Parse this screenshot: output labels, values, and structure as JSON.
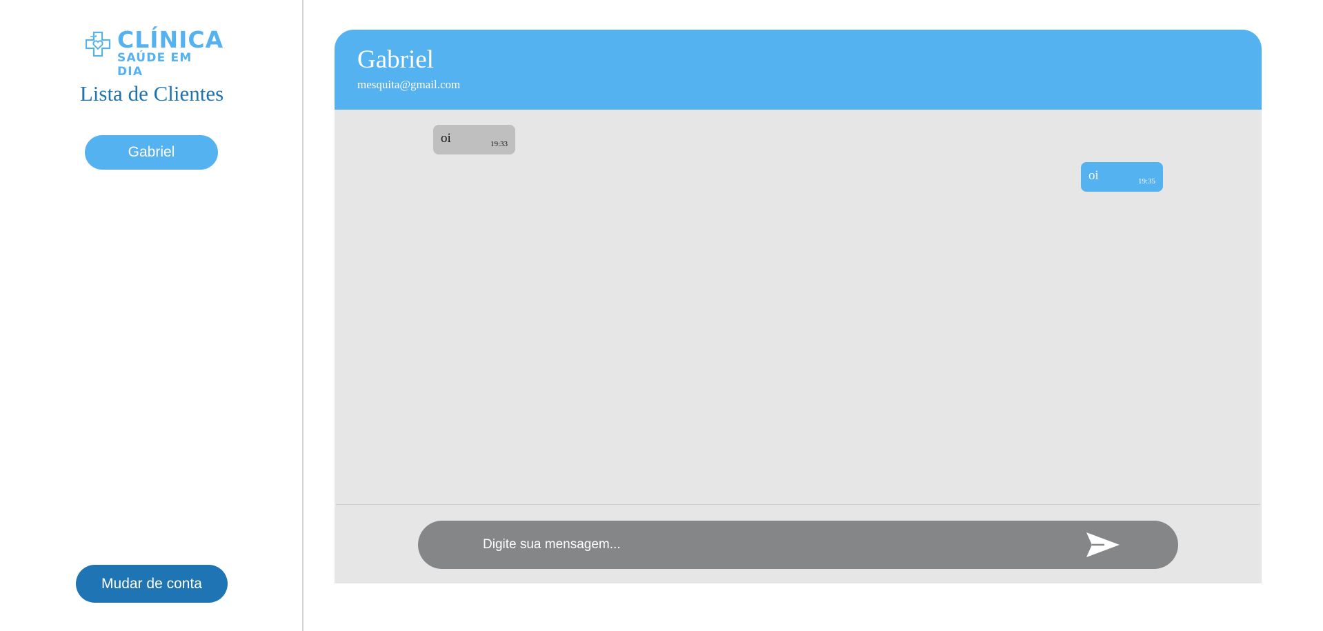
{
  "sidebar": {
    "logo": {
      "title": "CLÍNICA",
      "subtitle": "SAÚDE EM DIA"
    },
    "title": "Lista de Clientes",
    "clients": [
      "Gabriel"
    ],
    "switch_account_label": "Mudar de conta"
  },
  "chat": {
    "contact_name": "Gabriel",
    "contact_email": "mesquita@gmail.com",
    "messages": [
      {
        "direction": "received",
        "text": "oi",
        "time": "19:33"
      },
      {
        "direction": "sent",
        "text": "oi",
        "time": "19:35"
      }
    ],
    "input_placeholder": "Digite sua mensagem...",
    "send_icon": "paper-plane-icon"
  },
  "colors": {
    "accent": "#55b2f1",
    "dark_accent": "#1f74b3",
    "chat_background": "#e6e6e6",
    "received_bubble": "#bfbfbf",
    "input_bar": "#858688"
  }
}
